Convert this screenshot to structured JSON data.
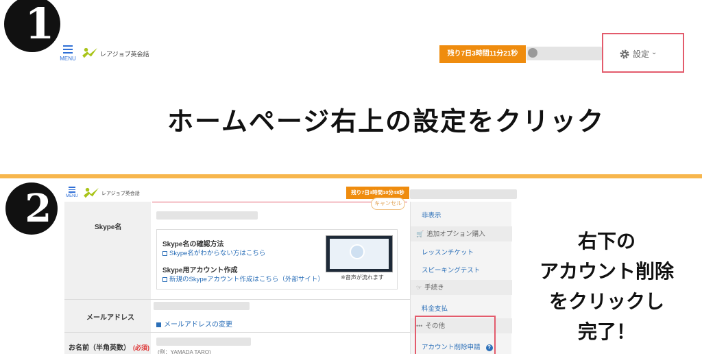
{
  "steps": {
    "step1_badge": "❶",
    "step2_badge": "❷",
    "step1_caption": "ホームページ右上の設定をクリック",
    "step2_caption_lines": [
      "右下の",
      "アカウント削除",
      "をクリックし",
      "完了！"
    ]
  },
  "header1": {
    "menu_label": "MENU",
    "logo_text": "レアジョブ英会話",
    "timer": "残り7日3時間11分21秒",
    "settings_label": "設定",
    "settings_caret": "⌄"
  },
  "header2": {
    "menu_label": "MENU",
    "logo_text": "レアジョブ英会話",
    "timer": "残り7日3時間10分48秒",
    "cancel_label": "キャンセル"
  },
  "form": {
    "skype_label": "Skype名",
    "skype_check_heading": "Skype名の確認方法",
    "skype_check_link": "Skype名がわからない方はこちら",
    "skype_create_heading": "Skype用アカウント作成",
    "skype_create_link": "新規のSkypeアカウント作成はこちら（外部サイト）",
    "video_caption": "※音声が流れます",
    "email_label": "メールアドレス",
    "email_change_link": "メールアドレスの変更",
    "name_label": "お名前（半角英数）",
    "required": "(必須)",
    "name_example": "(例：YAMADA TARO)"
  },
  "sidemenu": {
    "hide": "非表示",
    "cat_options": "追加オプション購入",
    "lesson_ticket": "レッスンチケット",
    "speaking_test": "スピーキングテスト",
    "cat_procedures": "手続き",
    "payment": "料金支払",
    "cat_other": "その他",
    "account_delete": "アカウント削除申請",
    "help_icon": "?"
  },
  "colors": {
    "accent_orange": "#ef8c0e",
    "highlight_red": "#e35b6c",
    "divider_orange": "#f7b64d",
    "link_blue": "#2b6fb8"
  },
  "icons": {
    "menu": "hamburger-icon",
    "settings": "gear-icon",
    "cart": "cart-icon",
    "hand": "hand-pointer-icon",
    "more": "dots-icon",
    "help": "help-circle-icon"
  }
}
